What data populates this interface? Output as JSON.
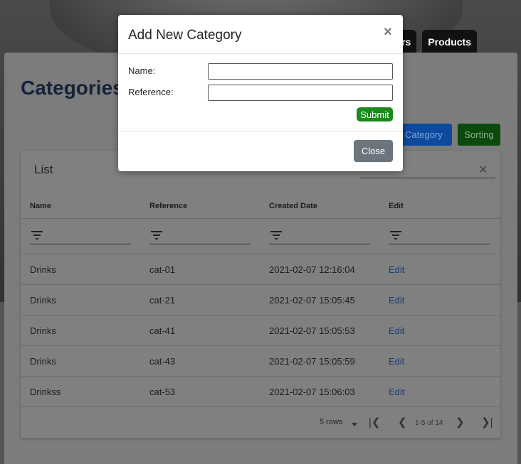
{
  "nav": {
    "items": [
      "ers",
      "Products"
    ]
  },
  "page": {
    "title": "Categories"
  },
  "toolbar": {
    "add_label": "Category",
    "sorting_label": "Sorting"
  },
  "table": {
    "title": "List",
    "search_clear": "✕",
    "headers": [
      "Name",
      "Reference",
      "Created Date",
      "Edit"
    ],
    "rows": [
      {
        "name": "Drinks",
        "reference": "cat-01",
        "created": "2021-02-07 12:16:04",
        "edit": "Edit"
      },
      {
        "name": "Drinks",
        "reference": "cat-21",
        "created": "2021-02-07 15:05:45",
        "edit": "Edit"
      },
      {
        "name": "Drinks",
        "reference": "cat-41",
        "created": "2021-02-07 15:05:53",
        "edit": "Edit"
      },
      {
        "name": "Drinks",
        "reference": "cat-43",
        "created": "2021-02-07 15:05:59",
        "edit": "Edit"
      },
      {
        "name": "Drinkss",
        "reference": "cat-53",
        "created": "2021-02-07 15:06:03",
        "edit": "Edit"
      }
    ]
  },
  "pagination": {
    "rows_label": "5 rows",
    "range": "1-5 of 14"
  },
  "modal": {
    "title": "Add New Category",
    "close_symbol": "×",
    "name_label": "Name:",
    "reference_label": "Reference:",
    "name_value": "",
    "reference_value": "",
    "submit_label": "Submit",
    "close_label": "Close"
  },
  "colors": {
    "submit": "#1a8a1a",
    "close_button": "#6c757d",
    "title": "#142338",
    "edit_link": "#153d78"
  }
}
